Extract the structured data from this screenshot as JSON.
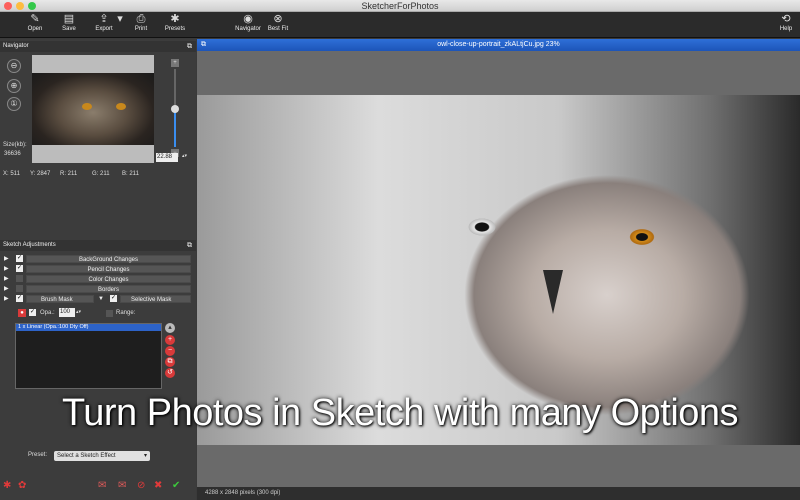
{
  "app": {
    "title": "SketcherForPhotos"
  },
  "toolbar": {
    "open": "Open",
    "save": "Save",
    "export": "Export",
    "print": "Print",
    "presets": "Presets",
    "navigator": "Navigator",
    "best_fit": "Best Fit",
    "help": "Help"
  },
  "navigator": {
    "title": "Navigator",
    "size_label": "Size(kb):",
    "size_value": "36636",
    "zoom_value": "22.88",
    "x": "X: 511",
    "y": "Y: 2847",
    "r": "R: 211",
    "g": "G: 211",
    "b": "B: 211"
  },
  "sketch": {
    "title": "Sketch Adjustments",
    "rows": [
      "BackGround Changes",
      "Pencil Changes",
      "Color Changes",
      "Borders"
    ],
    "brush_mask": "Brush Mask",
    "selective_mask": "Selective Mask",
    "opacity_label": "Opa.:",
    "opacity_value": "100",
    "range_label": "Range:",
    "layer_item": "1   x Linear (Opa.:100 Dty Off)"
  },
  "preset": {
    "label": "Preset:",
    "value": "Select a Sketch Effect"
  },
  "document": {
    "title": "owl-close-up-portrait_zkALtjCu.jpg 23%",
    "status": "4288 x 2848 pixels (300 dpi)"
  },
  "overlay_text": "Turn Photos  in Sketch with many Options"
}
